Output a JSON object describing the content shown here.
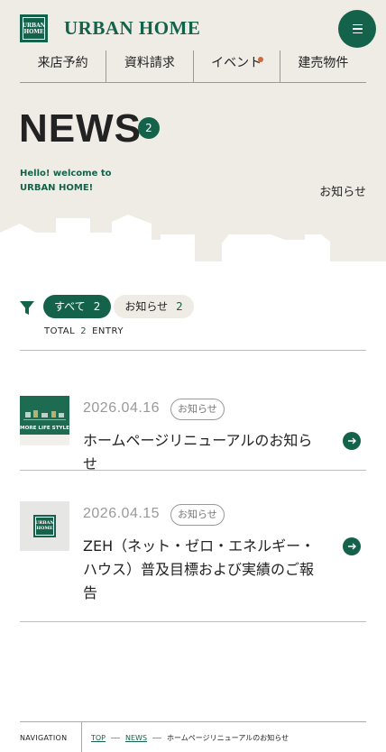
{
  "header": {
    "logo_mark_line1": "URBAN",
    "logo_mark_line2": "HOME",
    "logo_text": "URBAN HOME",
    "menu_icon": "hamburger-icon"
  },
  "topnav": [
    {
      "label": "来店予約",
      "badge": false
    },
    {
      "label": "資料請求",
      "badge": false
    },
    {
      "label": "イベント",
      "badge": true
    },
    {
      "label": "建売物件",
      "badge": false
    }
  ],
  "hero": {
    "title": "NEWS",
    "count": "2",
    "welcome_line1": "Hello! welcome to",
    "welcome_line2": "URBAN HOME!",
    "subtitle": "お知らせ"
  },
  "filter": {
    "icon": "filter-icon",
    "pills": [
      {
        "label": "すべて",
        "count": "2",
        "active": true
      },
      {
        "label": "お知らせ",
        "count": "2",
        "active": false
      }
    ],
    "total_label": "TOTAL",
    "total_count": "2",
    "entry_label": "ENTRY"
  },
  "news": [
    {
      "date": "2026.04.16",
      "category": "お知らせ",
      "title": "ホームページリニューアルのお知らせ",
      "thumb_caption": "MORE LIFE STYLE"
    },
    {
      "date": "2026.04.15",
      "category": "お知らせ",
      "title": "ZEH（ネット・ゼロ・エネルギー・ハウス）普及目標および実績のご報告",
      "thumb_caption": ""
    }
  ],
  "breadcrumb": {
    "label": "NAVIGATION",
    "items": [
      "TOP",
      "NEWS",
      "ホームページリニューアルのお知らせ"
    ]
  },
  "colors": {
    "brand_green": "#15624a",
    "hero_bg": "#efece6",
    "event_dot": "#cf6a3a"
  }
}
